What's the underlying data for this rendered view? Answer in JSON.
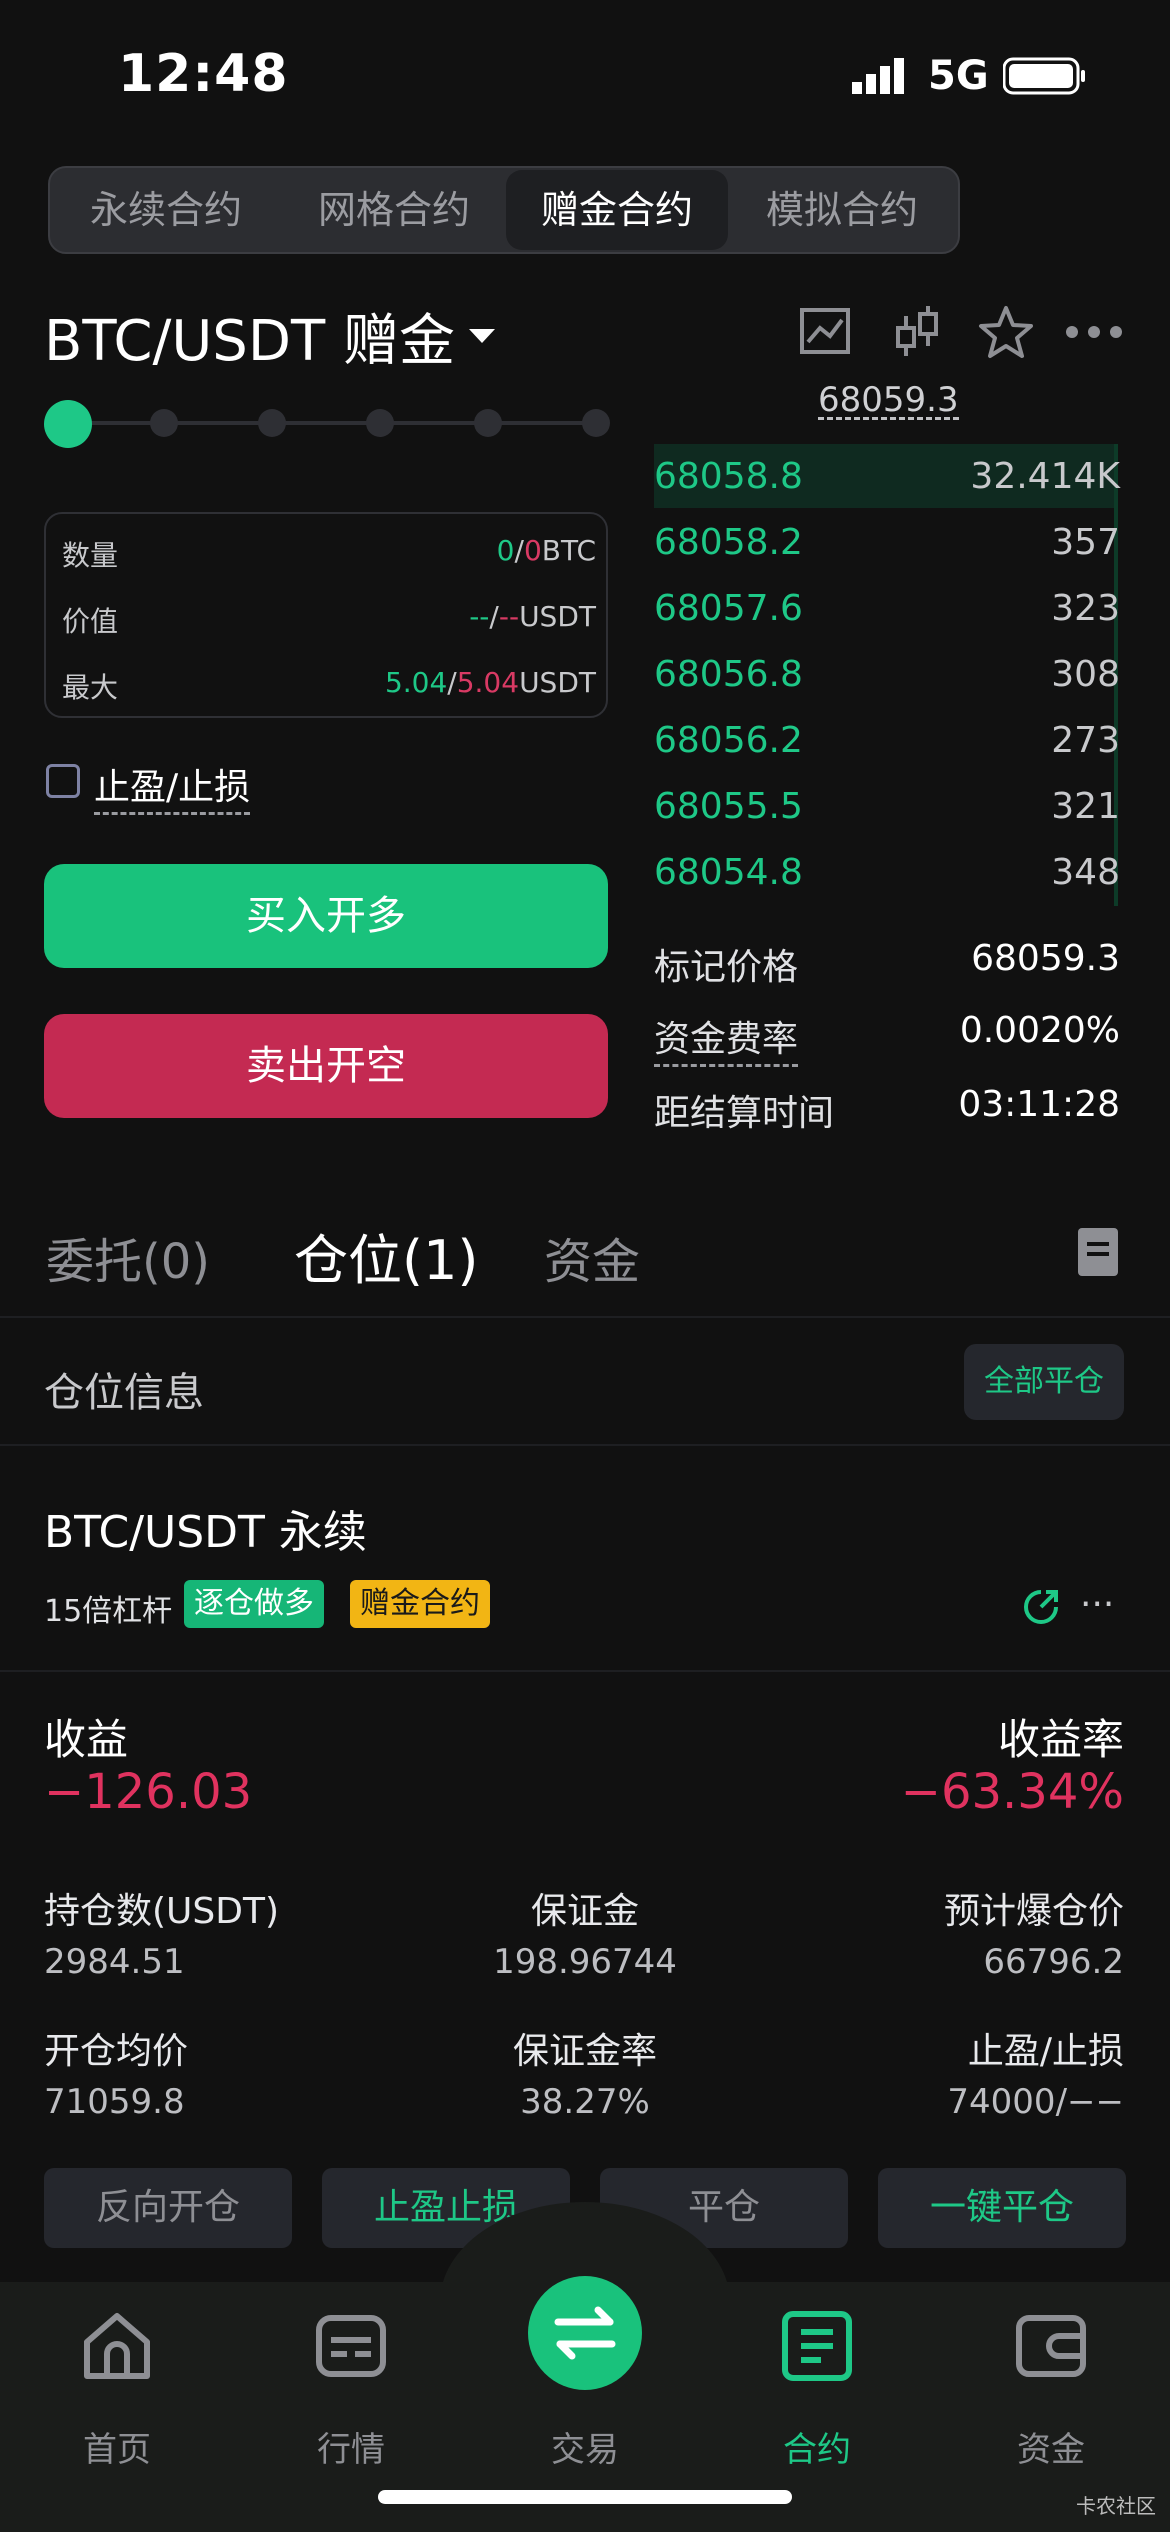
{
  "status_bar": {
    "time": "12:48",
    "network": "5G"
  },
  "top_tabs": [
    "永续合约",
    "网格合约",
    "赠金合约",
    "模拟合约"
  ],
  "pair": {
    "title": "BTC/USDT 赠金"
  },
  "info_box": {
    "rows": [
      {
        "label": "数量",
        "v1": "0",
        "sep": "/",
        "v2": "0",
        "unit": "BTC"
      },
      {
        "label": "价值",
        "v1": "--",
        "sep": "/",
        "v2": "--",
        "unit": "USDT"
      },
      {
        "label": "最大",
        "v1": "5.04",
        "sep": "/",
        "v2": "5.04",
        "unit": "USDT"
      }
    ]
  },
  "tp_sl_label": "止盈/止损",
  "buttons": {
    "buy": "买入开多",
    "sell": "卖出开空"
  },
  "orderbook": {
    "top_price": "68059.3",
    "rows": [
      {
        "price": "68058.8",
        "qty": "32.414K"
      },
      {
        "price": "68058.2",
        "qty": "357"
      },
      {
        "price": "68057.6",
        "qty": "323"
      },
      {
        "price": "68056.8",
        "qty": "308"
      },
      {
        "price": "68056.2",
        "qty": "273"
      },
      {
        "price": "68055.5",
        "qty": "321"
      },
      {
        "price": "68054.8",
        "qty": "348"
      }
    ]
  },
  "market_info": {
    "mark_price_label": "标记价格",
    "mark_price": "68059.3",
    "funding_label": "资金费率",
    "funding": "0.0020%",
    "settle_label": "距结算时间",
    "settle": "03:11:28"
  },
  "lower_tabs": {
    "orders": "委托(0)",
    "positions": "仓位(1)",
    "funds": "资金"
  },
  "positions_header": {
    "title": "仓位信息",
    "close_all": "全部平仓"
  },
  "position": {
    "symbol": "BTC/USDT 永续",
    "leverage": "15倍杠杆",
    "tag_mode": "逐仓做多",
    "tag_bonus": "赠金合约",
    "more": "...",
    "profit_label": "收益",
    "profit": "−126.03",
    "roi_label": "收益率",
    "roi": "−63.34%",
    "stats": [
      {
        "label": "持仓数(USDT)",
        "value": "2984.51"
      },
      {
        "label": "保证金",
        "value": "198.96744"
      },
      {
        "label": "预计爆仓价",
        "value": "66796.2"
      },
      {
        "label": "开仓均价",
        "value": "71059.8"
      },
      {
        "label": "保证金率",
        "value": "38.27%"
      },
      {
        "label": "止盈/止损",
        "value": "74000/−−"
      }
    ],
    "actions": [
      "反向开仓",
      "止盈止损",
      "平仓",
      "一键平仓"
    ]
  },
  "nav": [
    "首页",
    "行情",
    "交易",
    "合约",
    "资金"
  ],
  "watermark": "卡农社区",
  "colors": {
    "green": "#1ec887",
    "red": "#d93a64",
    "bonus_tag": "#f2b514"
  }
}
